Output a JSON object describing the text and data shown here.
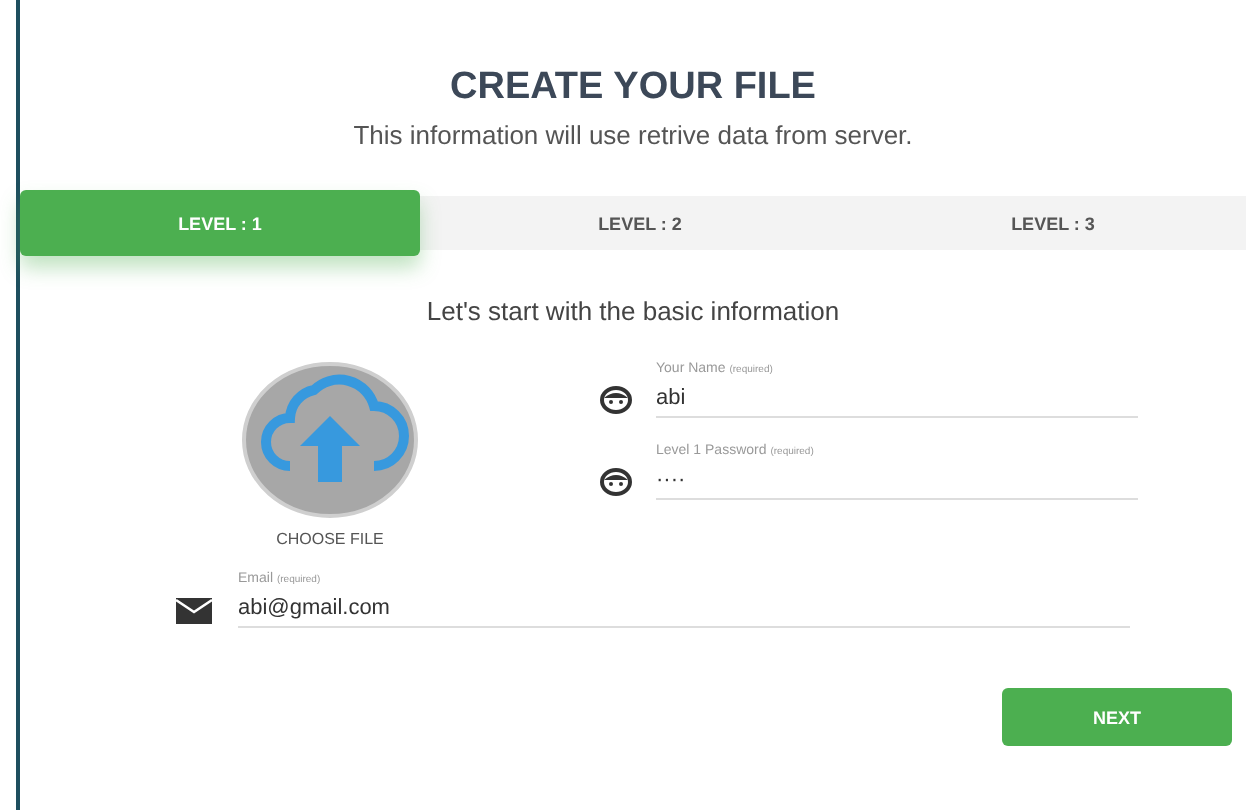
{
  "header": {
    "title": "CREATE YOUR FILE",
    "subtitle": "This information will use retrive data from server."
  },
  "tabs": [
    {
      "label": "LEVEL : 1",
      "selected": true
    },
    {
      "label": "LEVEL : 2",
      "selected": false
    },
    {
      "label": "LEVEL : 3",
      "selected": false
    }
  ],
  "step_heading": "Let's start with the basic information",
  "upload": {
    "label": "CHOOSE FILE"
  },
  "fields": [
    {
      "kind": "face",
      "label": "Your Name",
      "hint": "(required)",
      "value": "abi"
    },
    {
      "kind": "face",
      "label": "Level 1 Password",
      "hint": "(required)",
      "value": "····"
    }
  ],
  "email_field": {
    "kind": "mail",
    "label": "Email",
    "hint": "(required)",
    "value": "abi@gmail.com"
  },
  "next_button": "NEXT"
}
